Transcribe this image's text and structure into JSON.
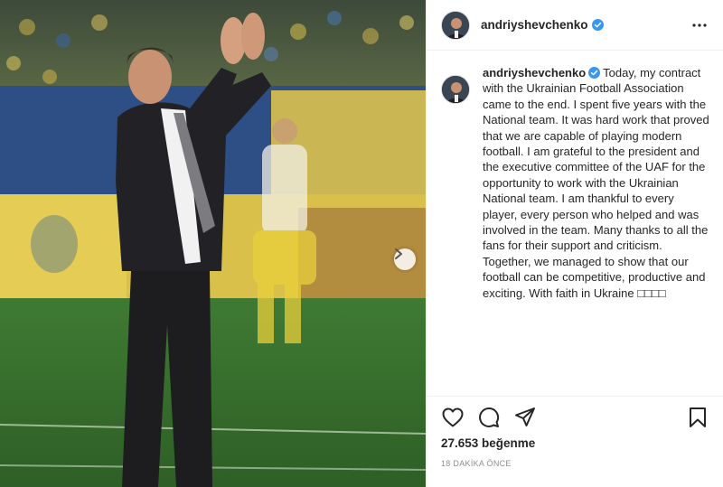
{
  "post": {
    "username": "andriyshevchenko",
    "verified": true,
    "more_icon": "more-horizontal-icon",
    "caption": "Today, my contract with the Ukrainian Football Association came to the end. I spent five years with the National team. It was hard work that proved that we are capable of playing modern football. I am grateful to the president and the executive committee of the UAF for the opportunity to work with the Ukrainian National team. I am thankful to every player, every person who helped and was involved in the team. Many thanks to all the fans for their support and criticism.\nTogether, we managed to show that our football can be competitive, productive and exciting. With faith in Ukraine □□□□",
    "likes": "27.653 beğenme",
    "time_ago": "18 DAKİKA ÖNCE"
  },
  "actions": {
    "like_icon": "heart-icon",
    "comment_icon": "comment-icon",
    "share_icon": "paper-plane-icon",
    "save_icon": "bookmark-icon"
  },
  "photo": {
    "next_icon": "chevron-right-icon"
  },
  "colors": {
    "verified_blue": "#3897f0",
    "text": "#262626",
    "muted": "#8e8e8e",
    "border": "#efefef"
  }
}
